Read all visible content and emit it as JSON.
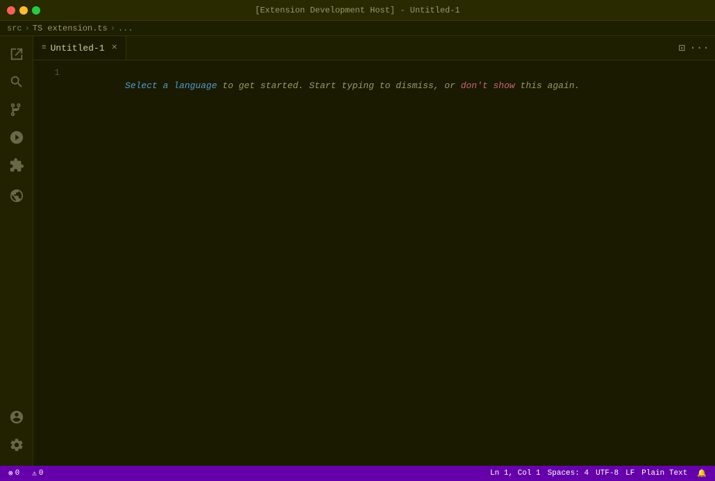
{
  "titlebar": {
    "title": "[Extension Development Host] - Untitled-1",
    "buttons": {
      "close_label": "close",
      "min_label": "minimize",
      "max_label": "maximize"
    }
  },
  "breadcrumb": {
    "parts": [
      "src",
      "TS extension.ts",
      "..."
    ]
  },
  "tabs": [
    {
      "label": "Untitled-1",
      "icon": "≡",
      "close": "×",
      "active": true
    }
  ],
  "tab_actions": {
    "split_label": "⊡",
    "more_label": "···"
  },
  "editor": {
    "lines": [
      {
        "number": "1",
        "segments": [
          {
            "text": "Select a language",
            "style": "link"
          },
          {
            "text": " to get started. Start typing to dismiss, or ",
            "style": "normal"
          },
          {
            "text": "don't show",
            "style": "link-red"
          },
          {
            "text": " this again.",
            "style": "normal"
          }
        ]
      }
    ]
  },
  "activity_bar": {
    "top_icons": [
      {
        "name": "explorer-icon",
        "label": "Explorer"
      },
      {
        "name": "search-icon",
        "label": "Search"
      },
      {
        "name": "source-control-icon",
        "label": "Source Control"
      },
      {
        "name": "run-icon",
        "label": "Run and Debug"
      },
      {
        "name": "extensions-icon",
        "label": "Extensions"
      },
      {
        "name": "remote-icon",
        "label": "Remote"
      }
    ],
    "bottom_icons": [
      {
        "name": "account-icon",
        "label": "Accounts"
      },
      {
        "name": "settings-icon",
        "label": "Settings"
      }
    ]
  },
  "statusbar": {
    "left": [
      {
        "text": "⊗ 0",
        "name": "errors-count"
      },
      {
        "text": "⚠ 0",
        "name": "warnings-count"
      }
    ],
    "right": [
      {
        "text": "Ln 1, Col 1",
        "name": "cursor-position"
      },
      {
        "text": "Spaces: 4",
        "name": "indentation"
      },
      {
        "text": "UTF-8",
        "name": "encoding"
      },
      {
        "text": "LF",
        "name": "eol"
      },
      {
        "text": "Plain Text",
        "name": "language-mode"
      },
      {
        "text": "🔔",
        "name": "notifications-bell"
      }
    ]
  }
}
